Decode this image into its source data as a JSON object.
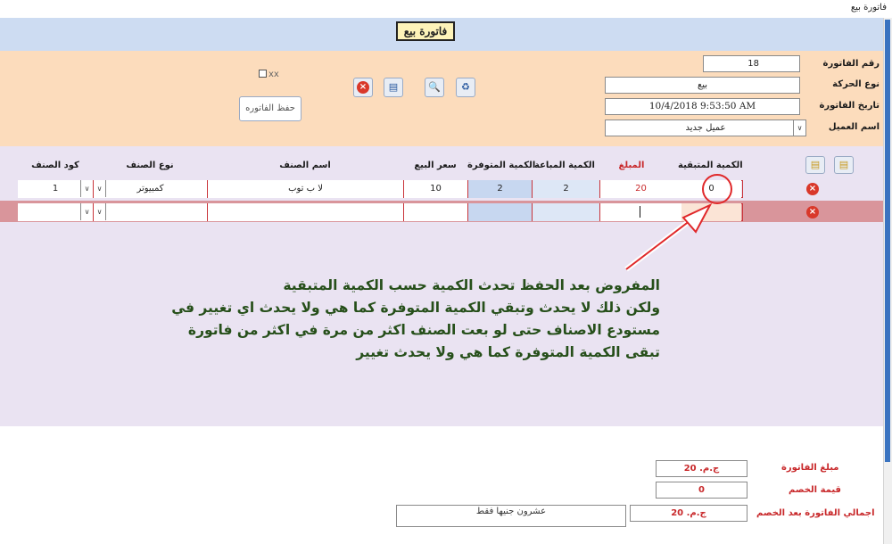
{
  "window": {
    "title": "فاتورة بيع"
  },
  "form": {
    "title": "فاتورة بيع"
  },
  "header": {
    "invoice_no_label": "رقم الفاتورة",
    "invoice_no_value": "18",
    "movement_type_label": "نوع الحركة",
    "movement_type_value": "بيع",
    "invoice_date_label": "تاريخ الفاتورة",
    "invoice_date_value": "10/4/2018 9:53:50 AM",
    "client_label": "اسم العميل",
    "client_value": "عميل جديد"
  },
  "toolbar": {
    "checkbox_label": "xx",
    "save_label": "حفظ الفاتوره"
  },
  "grid": {
    "columns": {
      "remaining": "الكمية المتبقية",
      "amount": "المبلغ",
      "sold_qty": "الكمية المباعة",
      "available_qty": "الكمية المتوفرة",
      "sale_price": "سعر البيع",
      "item_name": "اسم الصنف",
      "item_type": "نوع الصنف",
      "item_code": "كود الصنف"
    },
    "rows": [
      {
        "remaining": "0",
        "amount": "20",
        "sold_qty": "2",
        "available_qty": "2",
        "sale_price": "10",
        "item_name": "لا ب توب",
        "item_type": "كمبيوتر",
        "item_code": "1"
      },
      {
        "remaining": "",
        "amount": "",
        "sold_qty": "",
        "available_qty": "",
        "sale_price": "",
        "item_name": "",
        "item_type": "",
        "item_code": ""
      }
    ]
  },
  "annotation": {
    "line1": "المفروض بعد الحفظ تحدث الكمية حسب الكمية المتبقية",
    "line2": "ولكن ذلك لا يحدث وتبقي الكمية المتوفرة كما هي ولا يحدث اي تغيير في",
    "line3": "مستودع الاصناف حتى لو بعت الصنف اكثر من مرة في اكثر من فاتورة",
    "line4": "تبقى الكمية المتوفرة كما هي ولا يحدث تغيير"
  },
  "footer": {
    "invoice_amount_label": "مبلغ الفاتورة",
    "invoice_amount_value": "20 .ج.م",
    "discount_label": "قيمة الخصم",
    "discount_value": "0",
    "total_label": "اجمالي الفاتورة بعد الخصم",
    "total_value": "20 .ج.م",
    "total_words": "عشرون جنيها فقط"
  },
  "colors": {
    "header_band": "#cddcf2",
    "form_band": "#fcdcbc",
    "grid_band": "#eae3f2",
    "accent_red": "#c8282a",
    "annotation_text": "#264f1a",
    "arrow": "#e0282a"
  },
  "icons": [
    "close-icon",
    "recycle-bin-icon",
    "preview-icon",
    "print-icon",
    "add-row-icon",
    "delete-row-icon"
  ]
}
